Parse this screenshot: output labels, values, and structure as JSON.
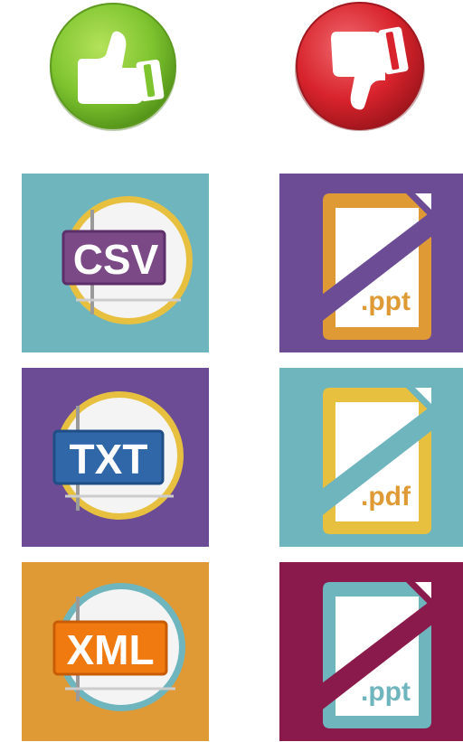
{
  "icons": {
    "thumbs_up": "thumbs-up-icon",
    "thumbs_down": "thumbs-down-icon"
  },
  "colors": {
    "teal": "#6eb5bd",
    "purple": "#6c4d95",
    "orange": "#df9a36",
    "maroon": "#8a1a4b",
    "green": "#7ec42f",
    "red": "#d8232c",
    "gold": "#e8c040",
    "white": "#ffffff"
  },
  "accepted": [
    {
      "label": "CSV",
      "bg": "#6eb5bd",
      "ring": "#e8c040",
      "badge": "#7b4a86"
    },
    {
      "label": "TXT",
      "bg": "#6c4d95",
      "ring": "#e8c040",
      "badge": "#2f67a8"
    },
    {
      "label": "XML",
      "bg": "#df9a36",
      "ring": "#6eb5bd",
      "badge": "#f07a10"
    }
  ],
  "rejected": [
    {
      "label": ".ppt",
      "bg": "#6c4d95",
      "frame": "#df9a36"
    },
    {
      "label": ".pdf",
      "bg": "#6eb5bd",
      "frame": "#e8c040"
    },
    {
      "label": ".ppt",
      "bg": "#8a1a4b",
      "frame": "#6eb5bd"
    }
  ]
}
